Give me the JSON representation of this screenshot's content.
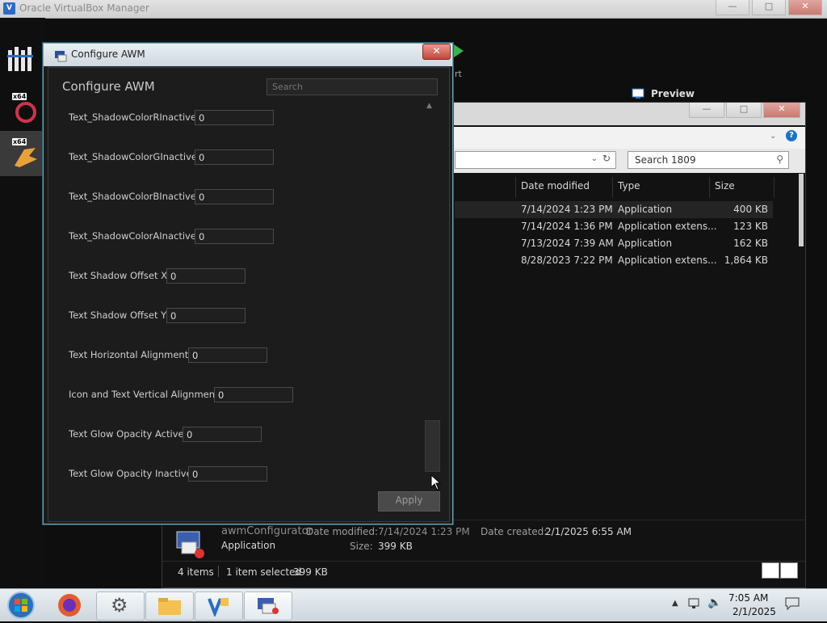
{
  "host": {
    "title": "Oracle VirtualBox Manager",
    "preview_label": "Preview",
    "toolbar_partial_label": "rt"
  },
  "explorer": {
    "search_placeholder": "Search 1809",
    "columns": [
      "Date modified",
      "Type",
      "Size"
    ],
    "files": [
      {
        "date": "7/14/2024 1:23 PM",
        "type": "Application",
        "size": "400 KB"
      },
      {
        "date": "7/14/2024 1:36 PM",
        "type": "Application extens...",
        "size": "123 KB"
      },
      {
        "date": "7/13/2024 7:39 AM",
        "type": "Application",
        "size": "162 KB"
      },
      {
        "date": "8/28/2023 7:22 PM",
        "type": "Application extens...",
        "size": "1,864 KB"
      }
    ],
    "details": {
      "name": "awmConfigurator",
      "type": "Application",
      "date_modified_label": "Date modified:",
      "date_modified": "7/14/2024 1:23 PM",
      "size_label": "Size:",
      "size": "399 KB",
      "date_created_label": "Date created:",
      "date_created": "2/1/2025 6:55 AM"
    },
    "status": {
      "items": "4 items",
      "selected": "1 item selected",
      "selected_size": "399 KB"
    }
  },
  "dialog": {
    "title": "Configure AWM",
    "heading": "Configure AWM",
    "search_placeholder": "Search",
    "apply_label": "Apply",
    "settings": [
      {
        "label": "Text_ShadowColorRInactive",
        "value": "0"
      },
      {
        "label": "Text_ShadowColorGInactive",
        "value": "0"
      },
      {
        "label": "Text_ShadowColorBInactive",
        "value": "0"
      },
      {
        "label": "Text_ShadowColorAInactive",
        "value": "0"
      },
      {
        "label": "Text Shadow Offset X",
        "value": "0"
      },
      {
        "label": "Text Shadow Offset Y",
        "value": "0"
      },
      {
        "label": "Text Horizontal Alignment",
        "value": "0"
      },
      {
        "label": "Icon and Text Vertical Alignment",
        "value": "0"
      },
      {
        "label": "Text Glow Opacity Active",
        "value": "0"
      },
      {
        "label": "Text Glow Opacity Inactive",
        "value": "0"
      }
    ]
  },
  "taskbar": {
    "time": "7:05 AM",
    "date": "2/1/2025"
  }
}
